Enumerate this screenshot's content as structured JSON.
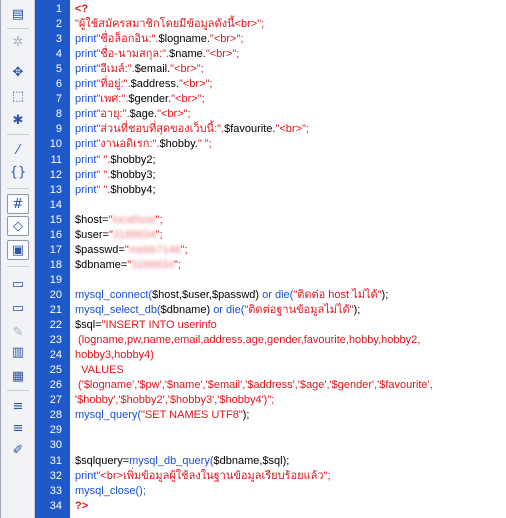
{
  "toolbar": {
    "buttons": [
      {
        "icon": "document-list-icon",
        "glyph": "▤",
        "state": "normal"
      },
      {
        "icon": "gear-icon",
        "glyph": "✲",
        "state": "disabled"
      },
      {
        "icon": "expand-arrows-icon",
        "glyph": "✥",
        "state": "normal"
      },
      {
        "icon": "dotted-box-icon",
        "glyph": "⬚",
        "state": "normal"
      },
      {
        "icon": "asterisk-arrows-icon",
        "glyph": "✱",
        "state": "normal"
      },
      {
        "icon": "wand-icon",
        "glyph": "⁄",
        "state": "normal"
      },
      {
        "icon": "braces-icon",
        "glyph": "{}",
        "state": "normal"
      },
      {
        "icon": "word-wrap-icon",
        "glyph": "#",
        "state": "boxed"
      },
      {
        "icon": "code-tag-icon",
        "glyph": "◇",
        "state": "boxed"
      },
      {
        "icon": "highlight-icon",
        "glyph": "▣",
        "state": "boxed"
      },
      {
        "icon": "comment-icon",
        "glyph": "▭",
        "state": "normal"
      },
      {
        "icon": "remove-comment-icon",
        "glyph": "▭",
        "state": "normal"
      },
      {
        "icon": "pencil-icon",
        "glyph": "✎",
        "state": "disabled"
      },
      {
        "icon": "format-document-icon",
        "glyph": "▥",
        "state": "normal"
      },
      {
        "icon": "chart-icon",
        "glyph": "▦",
        "state": "normal"
      },
      {
        "icon": "indent-icon",
        "glyph": "≡",
        "state": "normal"
      },
      {
        "icon": "outdent-icon",
        "glyph": "≡",
        "state": "normal"
      },
      {
        "icon": "brush-icon",
        "glyph": "✐",
        "state": "normal"
      }
    ]
  },
  "code_lines": [
    {
      "n": "1",
      "parts": [
        {
          "t": "<?",
          "c": "tag"
        }
      ]
    },
    {
      "n": "2",
      "parts": [
        {
          "t": "\"ผู้ใช้สมัครสมาชิกโดยมีข้อมูลดังนี้<br>\";",
          "c": "str"
        }
      ]
    },
    {
      "n": "3",
      "parts": [
        {
          "t": "print",
          "c": "kw"
        },
        {
          "t": "\"ชื่อล็อกอิน:\".",
          "c": "str"
        },
        {
          "t": "$logname.",
          "c": "plain"
        },
        {
          "t": "\"<br>\";",
          "c": "str"
        }
      ]
    },
    {
      "n": "4",
      "parts": [
        {
          "t": "print",
          "c": "kw"
        },
        {
          "t": "\"ชื่อ-นามสกุล:\".",
          "c": "str"
        },
        {
          "t": "$name.",
          "c": "plain"
        },
        {
          "t": "\"<br>\";",
          "c": "str"
        }
      ]
    },
    {
      "n": "5",
      "parts": [
        {
          "t": "print",
          "c": "kw"
        },
        {
          "t": "\"อีเมล์:\".",
          "c": "str"
        },
        {
          "t": "$email.",
          "c": "plain"
        },
        {
          "t": "\"<br>\";",
          "c": "str"
        }
      ]
    },
    {
      "n": "6",
      "parts": [
        {
          "t": "print",
          "c": "kw"
        },
        {
          "t": "\"ที่อยู่:\".",
          "c": "str"
        },
        {
          "t": "$address.",
          "c": "plain"
        },
        {
          "t": "\"<br>\";",
          "c": "str"
        }
      ]
    },
    {
      "n": "7",
      "parts": [
        {
          "t": "print",
          "c": "kw"
        },
        {
          "t": "\"เพศ:\".",
          "c": "str"
        },
        {
          "t": "$gender.",
          "c": "plain"
        },
        {
          "t": "\"<br>\";",
          "c": "str"
        }
      ]
    },
    {
      "n": "8",
      "parts": [
        {
          "t": "print",
          "c": "kw"
        },
        {
          "t": "\"อายุ:\".",
          "c": "str"
        },
        {
          "t": "$age.",
          "c": "plain"
        },
        {
          "t": "\"<br>\";",
          "c": "str"
        }
      ]
    },
    {
      "n": "9",
      "parts": [
        {
          "t": "print",
          "c": "kw"
        },
        {
          "t": "\"ส่วนที่ชอบที่สุดของเว็บนี้:\".",
          "c": "str"
        },
        {
          "t": "$favourite.",
          "c": "plain"
        },
        {
          "t": "\"<br>\";",
          "c": "str"
        }
      ]
    },
    {
      "n": "10",
      "parts": [
        {
          "t": "print",
          "c": "kw"
        },
        {
          "t": "\"งานอดิเรก:\".",
          "c": "str"
        },
        {
          "t": "$hobby.",
          "c": "plain"
        },
        {
          "t": "\" \";",
          "c": "str"
        }
      ]
    },
    {
      "n": "11",
      "parts": [
        {
          "t": "print",
          "c": "kw"
        },
        {
          "t": "\" \".",
          "c": "str"
        },
        {
          "t": "$hobby2;",
          "c": "plain"
        }
      ]
    },
    {
      "n": "12",
      "parts": [
        {
          "t": "print",
          "c": "kw"
        },
        {
          "t": "\" \".",
          "c": "str"
        },
        {
          "t": "$hobby3;",
          "c": "plain"
        }
      ]
    },
    {
      "n": "13",
      "parts": [
        {
          "t": "print",
          "c": "kw"
        },
        {
          "t": "\" \".",
          "c": "str"
        },
        {
          "t": "$hobby4;",
          "c": "plain"
        }
      ]
    },
    {
      "n": "14",
      "parts": []
    },
    {
      "n": "15",
      "parts": [
        {
          "t": "$host=",
          "c": "plain"
        },
        {
          "t": "\"",
          "c": "str"
        },
        {
          "t": "localhost",
          "c": "blur"
        },
        {
          "t": "\";",
          "c": "str"
        }
      ]
    },
    {
      "n": "16",
      "parts": [
        {
          "t": "$user=",
          "c": "plain"
        },
        {
          "t": "\"",
          "c": "str"
        },
        {
          "t": "3188834",
          "c": "blur"
        },
        {
          "t": "\";",
          "c": "str"
        }
      ]
    },
    {
      "n": "17",
      "parts": [
        {
          "t": "$passwd=",
          "c": "plain"
        },
        {
          "t": "\"",
          "c": "str"
        },
        {
          "t": "mebb7148",
          "c": "blur"
        },
        {
          "t": "\";",
          "c": "str"
        }
      ]
    },
    {
      "n": "18",
      "parts": [
        {
          "t": "$dbname=",
          "c": "plain"
        },
        {
          "t": "\"",
          "c": "str"
        },
        {
          "t": "3188834",
          "c": "blur"
        },
        {
          "t": "\";",
          "c": "str"
        }
      ]
    },
    {
      "n": "19",
      "parts": []
    },
    {
      "n": "20",
      "parts": [
        {
          "t": "mysql_connect(",
          "c": "kw"
        },
        {
          "t": "$host,$user,$passwd) ",
          "c": "plain"
        },
        {
          "t": "or die(",
          "c": "kw"
        },
        {
          "t": "\"ติดต่อ host ไม่ได้\"",
          "c": "str"
        },
        {
          "t": ");",
          "c": "plain"
        }
      ]
    },
    {
      "n": "21",
      "parts": [
        {
          "t": "mysql_select_db(",
          "c": "kw"
        },
        {
          "t": "$dbname) ",
          "c": "plain"
        },
        {
          "t": "or die(",
          "c": "kw"
        },
        {
          "t": "\"ติดต่อฐานข้อมูลไม่ได้\"",
          "c": "str"
        },
        {
          "t": ");",
          "c": "plain"
        }
      ]
    },
    {
      "n": "22",
      "parts": [
        {
          "t": "$sql=",
          "c": "plain"
        },
        {
          "t": "\"INSERT INTO userinfo",
          "c": "str"
        }
      ]
    },
    {
      "n": "23",
      "parts": [
        {
          "t": " (logname,pw,name,email,address,age,gender,favourite,hobby,hobby2,",
          "c": "str"
        }
      ]
    },
    {
      "n": "24",
      "parts": [
        {
          "t": "hobby3,hobby4)",
          "c": "str"
        }
      ]
    },
    {
      "n": "25",
      "parts": [
        {
          "t": "  VALUES",
          "c": "str"
        }
      ]
    },
    {
      "n": "26",
      "parts": [
        {
          "t": " ('$logname','$pw','$name','$email','$address','$age','$gender','$favourite',",
          "c": "str"
        }
      ]
    },
    {
      "n": "27",
      "parts": [
        {
          "t": "'$hobby','$hobby2','$hobby3','$hobby4')\";",
          "c": "str"
        }
      ]
    },
    {
      "n": "28",
      "parts": [
        {
          "t": "mysql_query(",
          "c": "kw"
        },
        {
          "t": "\"SET NAMES UTF8\"",
          "c": "str"
        },
        {
          "t": ");",
          "c": "plain"
        }
      ]
    },
    {
      "n": "29",
      "parts": []
    },
    {
      "n": "30",
      "parts": []
    },
    {
      "n": "31",
      "parts": [
        {
          "t": "$sqlquery=",
          "c": "plain"
        },
        {
          "t": "mysql_db_query(",
          "c": "kw"
        },
        {
          "t": "$dbname,$sql);",
          "c": "plain"
        }
      ]
    },
    {
      "n": "32",
      "parts": [
        {
          "t": "print",
          "c": "kw"
        },
        {
          "t": "\"<br>เพิ่มข้อมูลผู้ใช้ลงในฐานข้อมูลเรียบร้อยแล้ว\";",
          "c": "str"
        }
      ]
    },
    {
      "n": "33",
      "parts": [
        {
          "t": "mysql_close();",
          "c": "kw"
        }
      ]
    },
    {
      "n": "34",
      "parts": [
        {
          "t": "?>",
          "c": "tag"
        }
      ]
    }
  ]
}
